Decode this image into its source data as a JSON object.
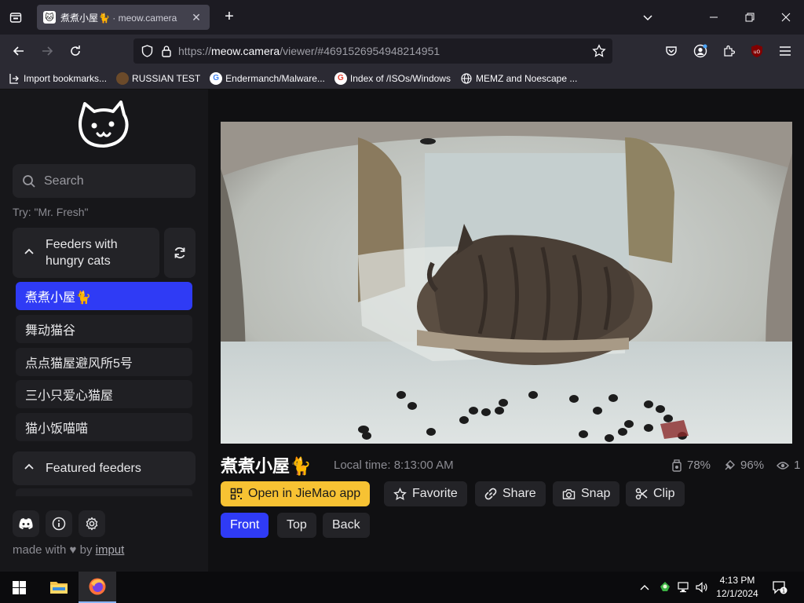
{
  "browser": {
    "tab": {
      "title": "煮煮小屋🐈",
      "site": " · meow.camera"
    },
    "url": {
      "protocol": "https://",
      "host": "meow.camera",
      "path": "/viewer/#4691526954948214951"
    },
    "bookmarks": [
      {
        "label": "Import bookmarks...",
        "icon": "import-icon"
      },
      {
        "label": "RUSSIAN TEST",
        "icon": "site-favicon"
      },
      {
        "label": "Endermanch/Malware...",
        "icon": "google-icon"
      },
      {
        "label": "Index of /ISOs/Windows",
        "icon": "google-icon"
      },
      {
        "label": "MEMZ and Noescape ...",
        "icon": "globe-icon"
      }
    ]
  },
  "sidebar": {
    "search_placeholder": "Search",
    "hint": "Try: \"Mr. Fresh\"",
    "group1": {
      "label": "Feeders with hungry cats",
      "line1": "Feeders with",
      "line2": "hungry cats"
    },
    "feeders": [
      "煮煮小屋🐈",
      "舞动猫谷",
      "点点猫屋避风所5号",
      "三小只爱心猫屋",
      "猫小饭喵喵"
    ],
    "group2": {
      "label": "Featured feeders"
    },
    "footer": {
      "made_prefix": "made with",
      "heart": "♥",
      "by": "by",
      "author": "imput"
    }
  },
  "viewer": {
    "name": "煮煮小屋🐈",
    "local_time": "Local time: 8:13:00 AM",
    "stats": {
      "food": "78%",
      "signal": "96%",
      "viewers": "1"
    },
    "actions": {
      "open_app": "Open in JieMao app",
      "favorite": "Favorite",
      "share": "Share",
      "snap": "Snap",
      "clip": "Clip"
    },
    "cameras": [
      "Front",
      "Top",
      "Back"
    ],
    "active_camera": "Front"
  },
  "taskbar": {
    "time": "4:13 PM",
    "date": "12/1/2024"
  },
  "colors": {
    "accent": "#2f3bf5",
    "app_button": "#f7c233"
  }
}
